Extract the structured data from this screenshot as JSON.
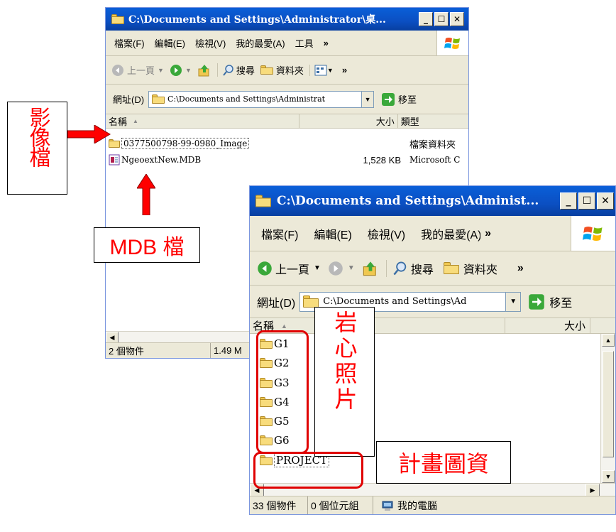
{
  "window1": {
    "title": "C:\\Documents and Settings\\Administrator\\桌...",
    "menu": [
      "檔案(F)",
      "編輯(E)",
      "檢視(V)",
      "我的最愛(A)",
      "工具"
    ],
    "menu_more": "»",
    "toolbar": {
      "back": "上一頁",
      "search": "搜尋",
      "folders": "資料夾",
      "more": "»"
    },
    "address_label": "網址(D)",
    "address_value": "C:\\Documents and Settings\\Administrat",
    "go_label": "移至",
    "columns": [
      "名稱",
      "大小",
      "類型"
    ],
    "files": [
      {
        "name": "0377500798-99-0980_Image",
        "size": "",
        "type": "檔案資料夾"
      },
      {
        "name": "NgeoextNew.MDB",
        "size": "1,528 KB",
        "type": "Microsoft C"
      }
    ],
    "status": [
      "2 個物件",
      "1.49 M"
    ]
  },
  "window2": {
    "title": "C:\\Documents and Settings\\Administ...",
    "menu": [
      "檔案(F)",
      "編輯(E)",
      "檢視(V)",
      "我的最愛(A)"
    ],
    "menu_more": "»",
    "toolbar": {
      "back": "上一頁",
      "search": "搜尋",
      "folders": "資料夾",
      "more": "»"
    },
    "address_label": "網址(D)",
    "address_value": "C:\\Documents and Settings\\Ad",
    "go_label": "移至",
    "columns": [
      "名稱",
      "大小"
    ],
    "folders": [
      "G1",
      "G2",
      "G3",
      "G4",
      "G5",
      "G6",
      "PROJECT"
    ],
    "status": [
      "33 個物件",
      "0 個位元組",
      "我的電腦"
    ]
  },
  "annotations": {
    "image_label": "影像檔",
    "mdb_label": "MDB 檔",
    "core_photo_label": "岩心照片",
    "project_label": "計畫圖資"
  },
  "colors": {
    "annotation": "#ff0000",
    "titlebar": "#0b55cc",
    "window_bg": "#ece9d8"
  }
}
